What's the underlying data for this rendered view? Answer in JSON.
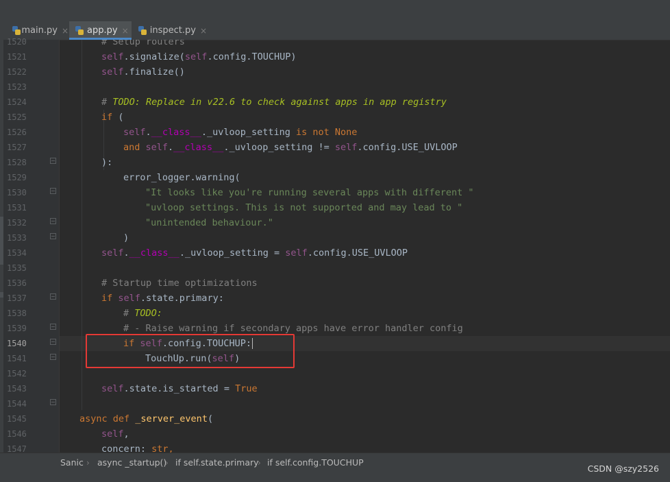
{
  "tabs": [
    {
      "label": "main.py",
      "close": "×",
      "active": false
    },
    {
      "label": "app.py",
      "close": "×",
      "active": true
    },
    {
      "label": "inspect.py",
      "close": "×",
      "active": false
    }
  ],
  "line_numbers": [
    "1520",
    "1521",
    "1522",
    "1523",
    "1524",
    "1525",
    "1526",
    "1527",
    "1528",
    "1529",
    "1530",
    "1531",
    "1532",
    "1533",
    "1534",
    "1535",
    "1536",
    "1537",
    "1538",
    "1539",
    "1540",
    "1541",
    "1542",
    "1543",
    "1544",
    "1545",
    "1546",
    "1547"
  ],
  "current_line": "1540",
  "code": {
    "l1520": "# Setup routers",
    "l1521_self": "self",
    "l1521_a": ".signalize(",
    "l1521_self2": "self",
    "l1521_b": ".config.TOUCHUP)",
    "l1522_self": "self",
    "l1522_a": ".finalize()",
    "l1524_hash": "# ",
    "l1524_todo": "TODO: Replace in v22.6 to check against apps in app registry",
    "l1525_kw": "if",
    "l1525_a": " (",
    "l1526_self": "self",
    "l1526_a": ".",
    "l1526_dunder": "__class__",
    "l1526_b": "._uvloop_setting ",
    "l1526_kw": "is not None",
    "l1527_kw": "and ",
    "l1527_self": "self",
    "l1527_a": ".",
    "l1527_dunder": "__class__",
    "l1527_b": "._uvloop_setting != ",
    "l1527_self2": "self",
    "l1527_c": ".config.USE_UVLOOP",
    "l1528": "):",
    "l1529": "error_logger.warning(",
    "l1530": "\"It looks like you're running several apps with different \"",
    "l1531": "\"uvloop settings. This is not supported and may lead to \"",
    "l1532": "\"unintended behaviour.\"",
    "l1533": ")",
    "l1534_self": "self",
    "l1534_a": ".",
    "l1534_dunder": "__class__",
    "l1534_b": "._uvloop_setting = ",
    "l1534_self2": "self",
    "l1534_c": ".config.USE_UVLOOP",
    "l1536": "# Startup time optimizations",
    "l1537_kw": "if ",
    "l1537_self": "self",
    "l1537_a": ".state.primary:",
    "l1538_hash": "# ",
    "l1538_todo": "TODO:",
    "l1539": "# - Raise warning if secondary apps have error handler config",
    "l1540_kw": "if ",
    "l1540_self": "self",
    "l1540_a": ".config.TOUCHUP:",
    "l1541_a": "TouchUp.run(",
    "l1541_self": "self",
    "l1541_b": ")",
    "l1543_self": "self",
    "l1543_a": ".state.is_started = ",
    "l1543_kw": "True",
    "l1545_kw": "async def ",
    "l1545_fn": "_server_event",
    "l1545_a": "(",
    "l1546_self": "self",
    "l1546_a": ",",
    "l1547_a": "concern: ",
    "l1547_b": "str,"
  },
  "breadcrumb": {
    "items": [
      "Sanic",
      "async _startup()",
      "if self.state.primary",
      "if self.config.TOUCHUP"
    ],
    "separator": "›"
  },
  "watermark": "CSDN @szy2526",
  "colors": {
    "editor_bg": "#2b2b2b",
    "keyword": "#cc7832",
    "self": "#94558d",
    "string": "#6a8759",
    "comment": "#808080",
    "todo": "#a8c023",
    "function": "#ffc66d",
    "highlight_box": "#e53935",
    "active_tab_underline": "#4a88c7"
  }
}
